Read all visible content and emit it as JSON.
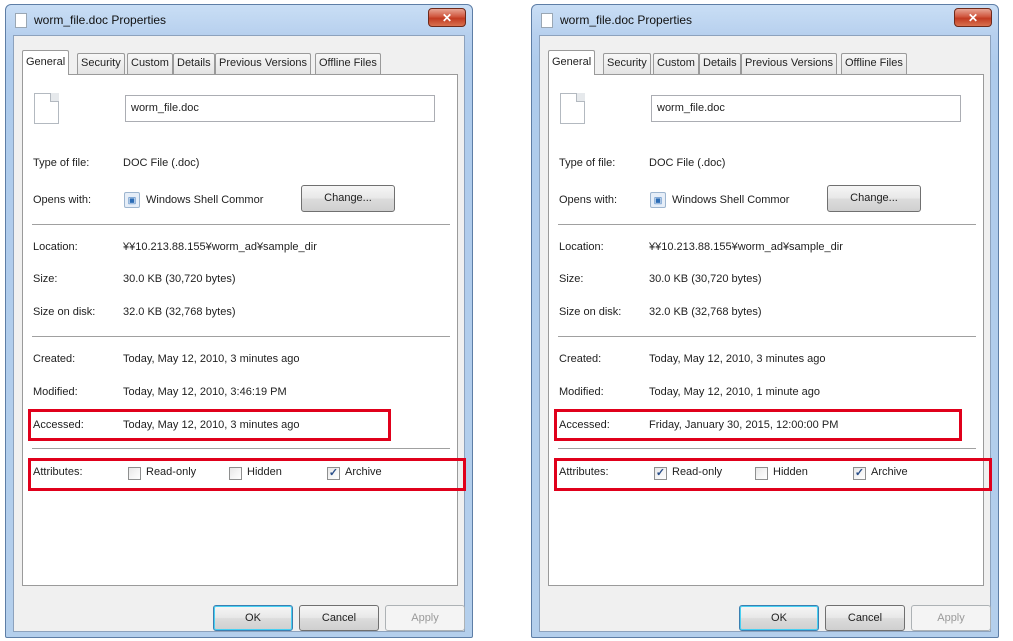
{
  "dialogs": [
    {
      "title": "worm_file.doc Properties",
      "close_glyph": "✕",
      "tabs": [
        "General",
        "Security",
        "Custom",
        "Details",
        "Previous Versions",
        "Offline Files"
      ],
      "file_name": "worm_file.doc",
      "type_label": "Type of file:",
      "type_value": "DOC File (.doc)",
      "opens_label": "Opens with:",
      "opens_value": "Windows Shell Commor",
      "change_label": "Change...",
      "location_label": "Location:",
      "location_value": "¥¥10.213.88.155¥worm_ad¥sample_dir",
      "size_label": "Size:",
      "size_value": "30.0 KB (30,720 bytes)",
      "size_on_disk_label": "Size on disk:",
      "size_on_disk_value": "32.0 KB (32,768 bytes)",
      "created_label": "Created:",
      "created_value": "Today, May 12, 2010, 3 minutes ago",
      "modified_label": "Modified:",
      "modified_value": "Today, May 12, 2010, 3:46:19 PM",
      "accessed_label": "Accessed:",
      "accessed_value": "Today, May 12, 2010, 3 minutes ago",
      "attributes_label": "Attributes:",
      "readonly_label": "Read-only",
      "readonly_checked": false,
      "hidden_label": "Hidden",
      "hidden_checked": false,
      "archive_label": "Archive",
      "archive_checked": true,
      "ok_label": "OK",
      "cancel_label": "Cancel",
      "apply_label": "Apply"
    },
    {
      "title": "worm_file.doc Properties",
      "close_glyph": "✕",
      "tabs": [
        "General",
        "Security",
        "Custom",
        "Details",
        "Previous Versions",
        "Offline Files"
      ],
      "file_name": "worm_file.doc",
      "type_label": "Type of file:",
      "type_value": "DOC File (.doc)",
      "opens_label": "Opens with:",
      "opens_value": "Windows Shell Commor",
      "change_label": "Change...",
      "location_label": "Location:",
      "location_value": "¥¥10.213.88.155¥worm_ad¥sample_dir",
      "size_label": "Size:",
      "size_value": "30.0 KB (30,720 bytes)",
      "size_on_disk_label": "Size on disk:",
      "size_on_disk_value": "32.0 KB (32,768 bytes)",
      "created_label": "Created:",
      "created_value": "Today, May 12, 2010, 3 minutes ago",
      "modified_label": "Modified:",
      "modified_value": "Today, May 12, 2010, 1 minute ago",
      "accessed_label": "Accessed:",
      "accessed_value": "Friday, January 30, 2015, 12:00:00 PM",
      "attributes_label": "Attributes:",
      "readonly_label": "Read-only",
      "readonly_checked": true,
      "hidden_label": "Hidden",
      "hidden_checked": false,
      "archive_label": "Archive",
      "archive_checked": true,
      "ok_label": "OK",
      "cancel_label": "Cancel",
      "apply_label": "Apply"
    }
  ],
  "colors": {
    "highlight_box": "#e0001b",
    "title_gradient": "#b7d0ee"
  }
}
